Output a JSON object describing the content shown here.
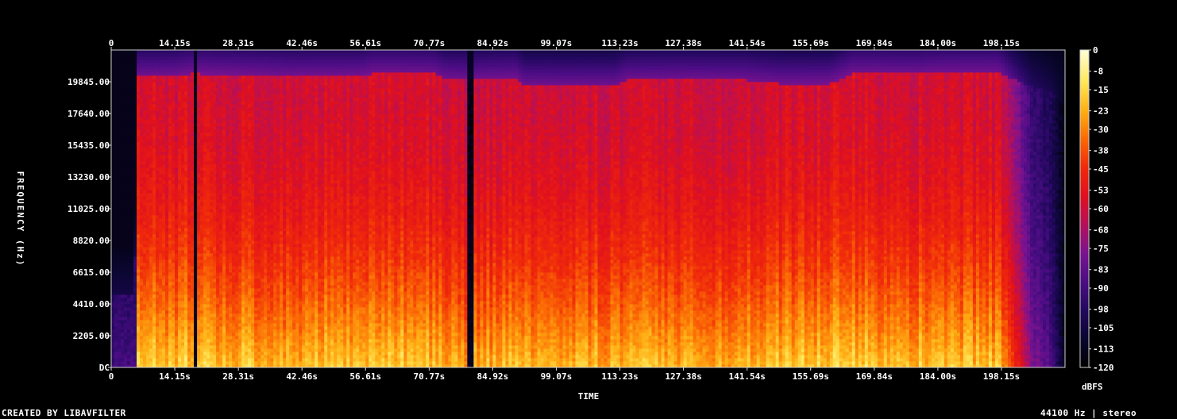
{
  "chart_data": {
    "type": "heatmap",
    "title": "",
    "xlabel": "TIME",
    "ylabel": "FREQUENCY (Hz)",
    "colorbar_label": "dBFS",
    "time_ticks": [
      "0",
      "14.15s",
      "28.31s",
      "42.46s",
      "56.61s",
      "70.77s",
      "84.92s",
      "99.07s",
      "113.23s",
      "127.38s",
      "141.54s",
      "155.69s",
      "169.84s",
      "184.00s",
      "198.15s"
    ],
    "time_tick_values_s": [
      0,
      14.15,
      28.31,
      42.46,
      56.61,
      70.77,
      84.92,
      99.07,
      113.23,
      127.38,
      141.54,
      155.69,
      169.84,
      184.0,
      198.15
    ],
    "xlim_s": [
      0,
      212.3
    ],
    "freq_ticks": [
      "DC",
      "2205.00",
      "4410.00",
      "6615.00",
      "8820.00",
      "11025.00",
      "13230.00",
      "15435.00",
      "17640.00",
      "19845.00"
    ],
    "freq_tick_values_hz": [
      0,
      2205,
      4410,
      6615,
      8820,
      11025,
      13230,
      15435,
      17640,
      19845
    ],
    "ylim_hz": [
      0,
      22050
    ],
    "colorbar_ticks": [
      "0",
      "-8",
      "-15",
      "-23",
      "-30",
      "-38",
      "-45",
      "-53",
      "-60",
      "-68",
      "-75",
      "-83",
      "-90",
      "-98",
      "-105",
      "-113",
      "-120"
    ],
    "colorbar_values_dbfs": [
      0,
      -8,
      -15,
      -23,
      -30,
      -38,
      -45,
      -53,
      -60,
      -68,
      -75,
      -83,
      -90,
      -98,
      -105,
      -113,
      -120
    ],
    "zlim_dbfs": [
      -120,
      0
    ],
    "colormap": [
      "#000000",
      "#0a0630",
      "#22085e",
      "#4b0d84",
      "#7a1390",
      "#b5105a",
      "#e0101e",
      "#f02a0a",
      "#fb6a05",
      "#ffb015",
      "#ffe85a",
      "#ffffd8"
    ],
    "cutoff_profile_hz": {
      "time_s": [
        0,
        5.2,
        5.8,
        14.0,
        18.0,
        19.0,
        56.0,
        58.0,
        72.0,
        74.0,
        90.0,
        92.0,
        112.0,
        115.0,
        140.0,
        150.0,
        160.0,
        165.0,
        180.0,
        185.0,
        197.0,
        205.0,
        210.0,
        212.3
      ],
      "max_freq_hz": [
        5000,
        5000,
        20200,
        20200,
        20400,
        20400,
        20200,
        20400,
        20400,
        20100,
        20100,
        19600,
        19600,
        20000,
        20000,
        19700,
        19700,
        20400,
        20400,
        20500,
        20500,
        19500,
        19000,
        19000
      ]
    },
    "loudness_profile": {
      "time_s": [
        0,
        5.5,
        6.0,
        19.0,
        40.0,
        56.0,
        72.0,
        78.0,
        90.0,
        112.0,
        126.0,
        140.0,
        160.0,
        180.0,
        198.0,
        205.0,
        209.0,
        212.3
      ],
      "level": [
        0.25,
        0.25,
        0.88,
        0.9,
        0.86,
        0.9,
        0.88,
        0.84,
        0.87,
        0.86,
        0.87,
        0.86,
        0.9,
        0.88,
        0.88,
        0.4,
        0.3,
        0.05
      ]
    },
    "silence_gaps_s": [
      18.9,
      79.6,
      80.0
    ]
  },
  "footer": {
    "credit": "CREATED BY LIBAVFILTER",
    "info": "44100 Hz | stereo"
  }
}
